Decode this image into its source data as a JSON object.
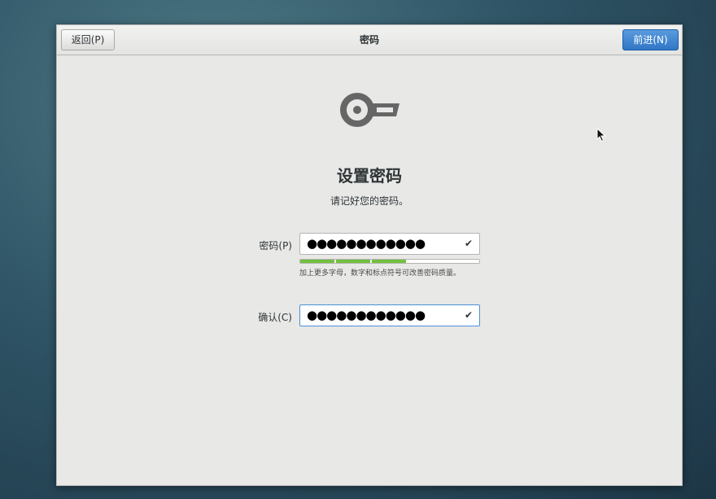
{
  "header": {
    "back_label": "返回(P)",
    "title": "密码",
    "next_label": "前进(N)"
  },
  "content": {
    "icon": "key-icon",
    "title": "设置密码",
    "subtitle": "请记好您的密码。"
  },
  "password": {
    "label": "密码(P)",
    "masked_value": "●●●●●●●●●●●●",
    "valid_icon": "check-icon",
    "strength_fraction": 0.6,
    "hint": "加上更多字母，数字和标点符号可改善密码质量。"
  },
  "confirm": {
    "label": "确认(C)",
    "masked_value": "●●●●●●●●●●●●",
    "valid_icon": "check-icon"
  },
  "colors": {
    "accent": "#3a80cf",
    "strength_bar": "#73c040",
    "background": "#e8e8e7"
  }
}
